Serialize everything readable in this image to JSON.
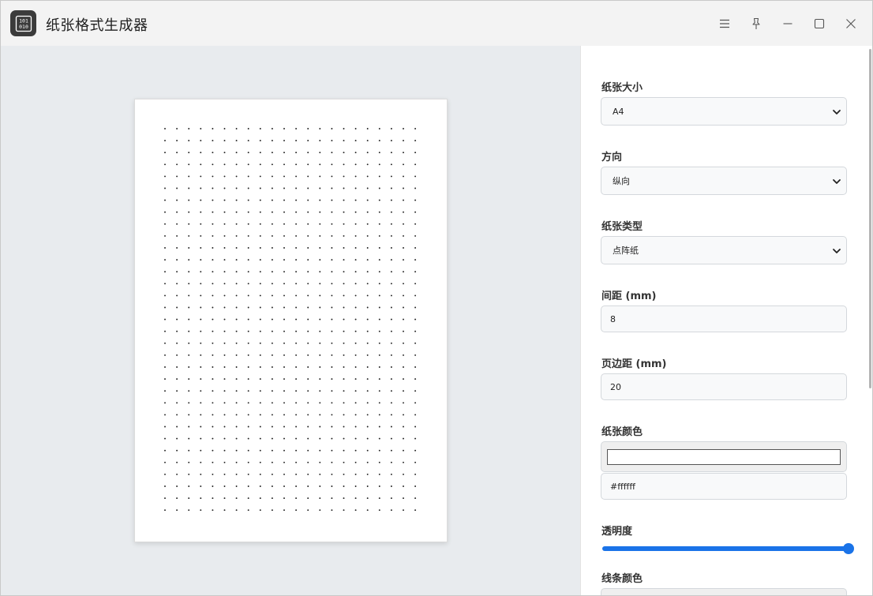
{
  "window": {
    "title": "纸张格式生成器",
    "icon": "binary-icon"
  },
  "titlebar_buttons": [
    "menu-icon",
    "pin-icon",
    "minimize-icon",
    "maximize-icon",
    "close-icon"
  ],
  "preview": {
    "paper_type": "dot-grid",
    "paper_color": "#ffffff",
    "dot_color": "#222222",
    "dot_columns": 22,
    "dot_rows": 33
  },
  "settings": {
    "paper_size": {
      "label": "纸张大小",
      "value": "A4"
    },
    "orientation": {
      "label": "方向",
      "value": "纵向"
    },
    "paper_type": {
      "label": "纸张类型",
      "value": "点阵纸"
    },
    "spacing": {
      "label": "间距 (mm)",
      "value": "8"
    },
    "margin": {
      "label": "页边距 (mm)",
      "value": "20"
    },
    "paper_color": {
      "label": "纸张颜色",
      "swatch": "#ffffff",
      "hex": "#ffffff"
    },
    "opacity": {
      "label": "透明度",
      "value": 1.0
    },
    "line_color": {
      "label": "线条颜色"
    }
  },
  "colors": {
    "accent": "#1a73e8"
  }
}
